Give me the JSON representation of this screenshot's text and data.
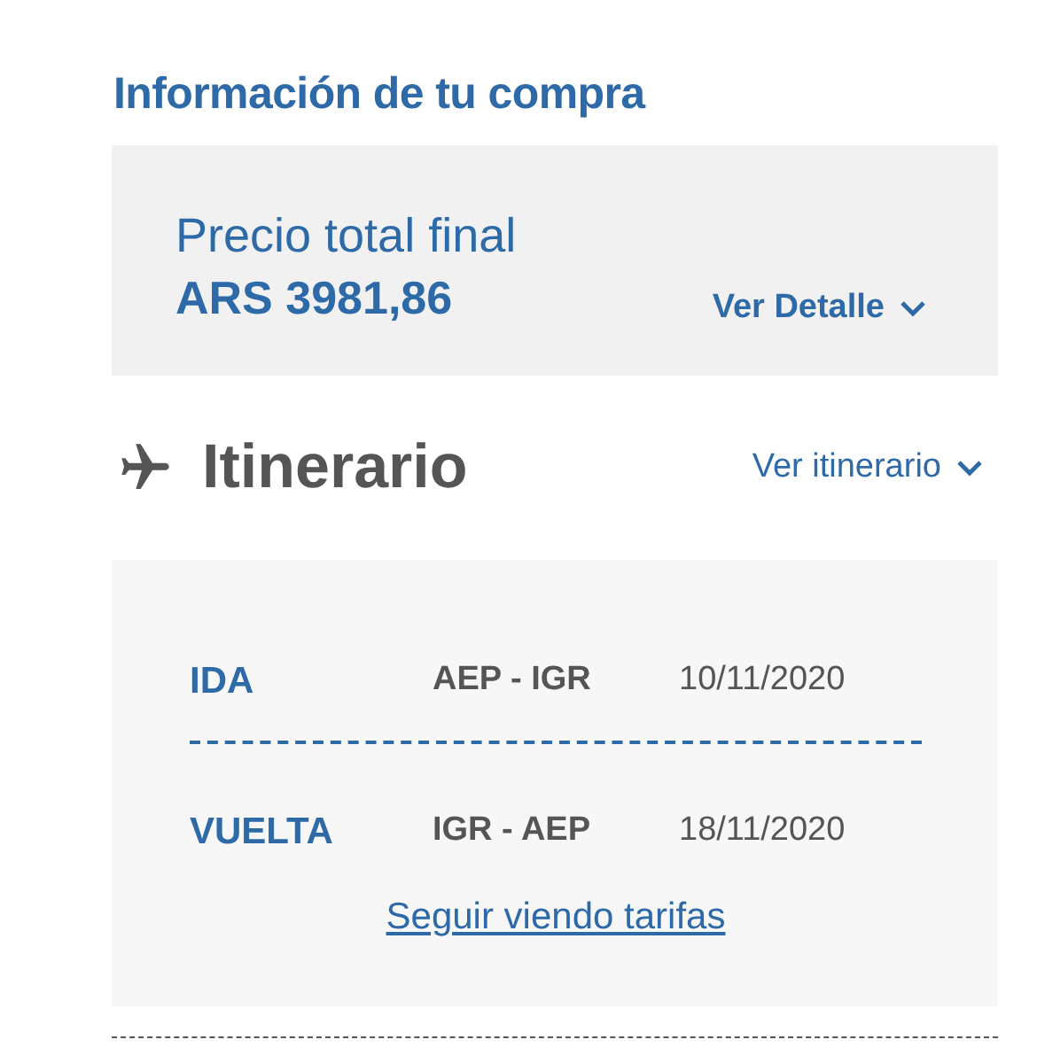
{
  "purchase": {
    "title": "Información de tu compra",
    "price_label": "Precio total final",
    "price": "ARS 3981,86",
    "detail_link": "Ver Detalle"
  },
  "itinerary": {
    "title": "Itinerario",
    "toggle_link": "Ver itinerario",
    "legs": [
      {
        "label": "IDA",
        "route": "AEP - IGR",
        "date": "10/11/2020"
      },
      {
        "label": "VUELTA",
        "route": "IGR - AEP",
        "date": "18/11/2020"
      }
    ],
    "more_link": "Seguir viendo tarifas"
  }
}
